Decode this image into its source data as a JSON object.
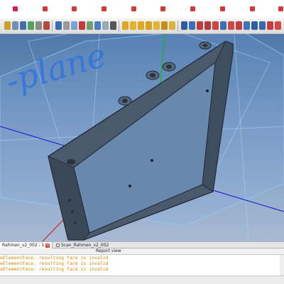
{
  "viewport": {
    "plane_label": "-plane"
  },
  "tabs": [
    {
      "label": "Rahmen_v2_002 : 1",
      "active": true
    },
    {
      "label": "Scan_Rahmen_v2_002",
      "active": false
    }
  ],
  "report": {
    "title": "Report view",
    "lines": [
      "eElementFace: resulting face is invalid",
      "eElementFace: resulting face is invalid",
      "eElementFace: resulting face is invalid",
      "eElementFace: resulting face is invalid"
    ]
  },
  "colors": {
    "warning_text": "#d28a00",
    "plane_label": "#2e74df",
    "axis_x": "#1010d0",
    "axis_y": "#00c000",
    "axis_z": "#d01010"
  },
  "icons": {
    "toolbar": [
      "macro-icon",
      "document-icon",
      "save-icon",
      "view-icon",
      "measure-icon",
      "part-icon",
      "box-icon",
      "cylinder-icon",
      "sphere-icon",
      "boolean-icon",
      "sketch-icon",
      "extrude-icon"
    ]
  }
}
